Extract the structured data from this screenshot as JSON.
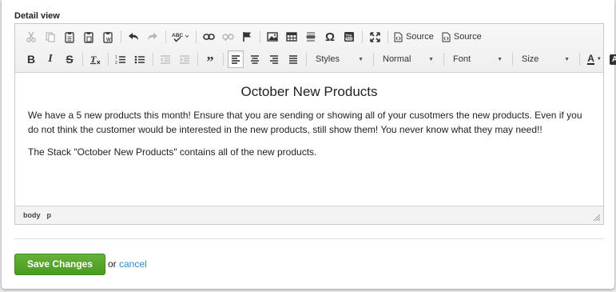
{
  "panel": {
    "label": "Detail view"
  },
  "toolbar": {
    "row1": [
      {
        "icon": "cut-icon",
        "enabled": false
      },
      {
        "icon": "copy-icon",
        "enabled": false
      },
      {
        "icon": "paste-icon",
        "enabled": true
      },
      {
        "icon": "paste-text-icon",
        "enabled": true
      },
      {
        "icon": "paste-from-word-icon",
        "enabled": true
      },
      {
        "icon": "undo-icon",
        "enabled": true
      },
      {
        "icon": "redo-icon",
        "enabled": false
      },
      {
        "icon": "spellcheck-icon",
        "enabled": true,
        "text": "ABC"
      },
      {
        "icon": "link-icon",
        "enabled": true
      },
      {
        "icon": "unlink-icon",
        "enabled": false
      },
      {
        "icon": "anchor-flag-icon",
        "enabled": true
      },
      {
        "icon": "image-icon",
        "enabled": true
      },
      {
        "icon": "table-icon",
        "enabled": true
      },
      {
        "icon": "horizontal-line-icon",
        "enabled": true
      },
      {
        "icon": "special-character-icon",
        "enabled": true,
        "text": "Ω"
      },
      {
        "icon": "youtube-icon",
        "enabled": true
      },
      {
        "icon": "maximize-icon",
        "enabled": true
      }
    ],
    "source_label_1": "Source",
    "source_label_2": "Source",
    "styles": {
      "value": "Styles"
    },
    "format": {
      "value": "Normal"
    },
    "font": {
      "value": "Font"
    },
    "size": {
      "value": "Size"
    },
    "text_color_letter": "A",
    "bg_color_letter": "A"
  },
  "content": {
    "heading": "October New Products",
    "paragraph1": "We have a 5 new products this month! Ensure that you are sending or showing all of your cusotmers the new products. Even if you do not think the customer would be interested in the new products, still show them! You never know what they may need!!",
    "paragraph2": "The Stack \"October New Products\" contains all of the new products."
  },
  "statusbar": {
    "path": [
      "body",
      "p"
    ]
  },
  "actions": {
    "save_label": "Save Changes",
    "or_text": "or",
    "cancel_label": "cancel"
  },
  "colors": {
    "save_button": "#55a52d",
    "link": "#2a8ec6",
    "toolbar_bg": "#f2f2f2"
  }
}
